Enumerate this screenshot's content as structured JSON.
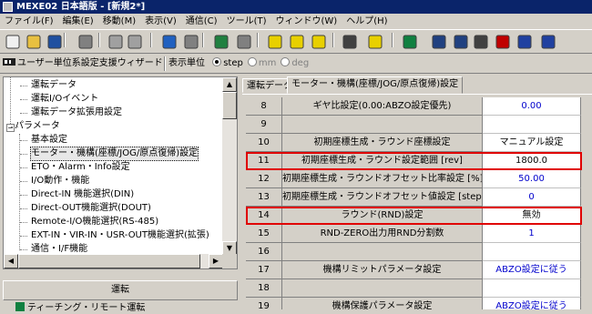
{
  "window": {
    "title": "MEXE02 日本語版 - [新規2*]"
  },
  "menu": [
    "ファイル(F)",
    "編集(E)",
    "移動(M)",
    "表示(V)",
    "通信(C)",
    "ツール(T)",
    "ウィンドウ(W)",
    "ヘルプ(H)"
  ],
  "toolbar": {
    "icons": [
      "new-file-icon",
      "open-folder-icon",
      "save-icon",
      "print-icon",
      "copy-icon",
      "paste-icon",
      "undo-icon",
      "redo-icon",
      "connect-icon",
      "disconnect-icon",
      "upload-icon",
      "download-icon",
      "compare-icon",
      "io-icon",
      "help-icon",
      "stop-icon",
      "teaching-icon",
      "monitor-icon",
      "io-monitor-icon",
      "alarm-icon",
      "status-icon",
      "rs485-icon"
    ]
  },
  "toolbar2": {
    "wizard_label": "ユーザー単位系設定支援ウィザード",
    "unit_label": "表示単位",
    "units": [
      {
        "label": "step",
        "selected": true
      },
      {
        "label": "mm",
        "selected": false
      },
      {
        "label": "deg",
        "selected": false
      }
    ]
  },
  "tree": {
    "items": [
      {
        "label": "運転データ",
        "level": 2
      },
      {
        "label": "運転I/Oイベント",
        "level": 2
      },
      {
        "label": "運転データ拡張用設定",
        "level": 2
      },
      {
        "label": "パラメータ",
        "level": 1
      },
      {
        "label": "基本設定",
        "level": 2
      },
      {
        "label": "モーター・機構(座標/JOG/原点復帰)設定",
        "level": 2,
        "selected": true
      },
      {
        "label": "ETO・Alarm・Info設定",
        "level": 2
      },
      {
        "label": "I/O動作・機能",
        "level": 2
      },
      {
        "label": "Direct-IN 機能選択(DIN)",
        "level": 2
      },
      {
        "label": "Direct-OUT機能選択(DOUT)",
        "level": 2
      },
      {
        "label": "Remote-I/O機能選択(RS-485)",
        "level": 2
      },
      {
        "label": "EXT-IN・VIR-IN・USR-OUT機能選択(拡張)",
        "level": 2
      },
      {
        "label": "通信・I/F機能",
        "level": 2
      }
    ]
  },
  "bottom_panel": {
    "header": "運転",
    "item": "ティーチング・リモート運転"
  },
  "tabs": [
    {
      "label": "運転データ",
      "active": false
    },
    {
      "label": "モーター・機構(座標/JOG/原点復帰)設定",
      "active": true
    }
  ],
  "parameters": [
    {
      "no": "8",
      "name": "ギヤ比設定(0.00:ABZO設定優先)",
      "value": "0.00",
      "value_color": "blue",
      "highlight": false
    },
    {
      "no": "9",
      "name": "",
      "value": "",
      "value_color": "black",
      "highlight": false
    },
    {
      "no": "10",
      "name": "初期座標生成・ラウンド座標設定",
      "value": "マニュアル設定",
      "value_color": "black",
      "highlight": false
    },
    {
      "no": "11",
      "name": "初期座標生成・ラウンド設定範囲 [rev]",
      "value": "1800.0",
      "value_color": "black",
      "highlight": true
    },
    {
      "no": "12",
      "name": "初期座標生成・ラウンドオフセット比率設定 [%]",
      "value": "50.00",
      "value_color": "blue",
      "highlight": false
    },
    {
      "no": "13",
      "name": "初期座標生成・ラウンドオフセット値設定 [step]",
      "value": "0",
      "value_color": "blue",
      "highlight": false
    },
    {
      "no": "14",
      "name": "ラウンド(RND)設定",
      "value": "無効",
      "value_color": "black",
      "highlight": true
    },
    {
      "no": "15",
      "name": "RND-ZERO出力用RND分割数",
      "value": "1",
      "value_color": "blue",
      "highlight": false
    },
    {
      "no": "16",
      "name": "",
      "value": "",
      "value_color": "black",
      "highlight": false
    },
    {
      "no": "17",
      "name": "機構リミットパラメータ設定",
      "value": "ABZO設定に従う",
      "value_color": "blue",
      "highlight": false
    },
    {
      "no": "18",
      "name": "",
      "value": "",
      "value_color": "black",
      "highlight": false
    },
    {
      "no": "19",
      "name": "機構保護パラメータ設定",
      "value": "ABZO設定に従う",
      "value_color": "blue",
      "highlight": false
    }
  ]
}
